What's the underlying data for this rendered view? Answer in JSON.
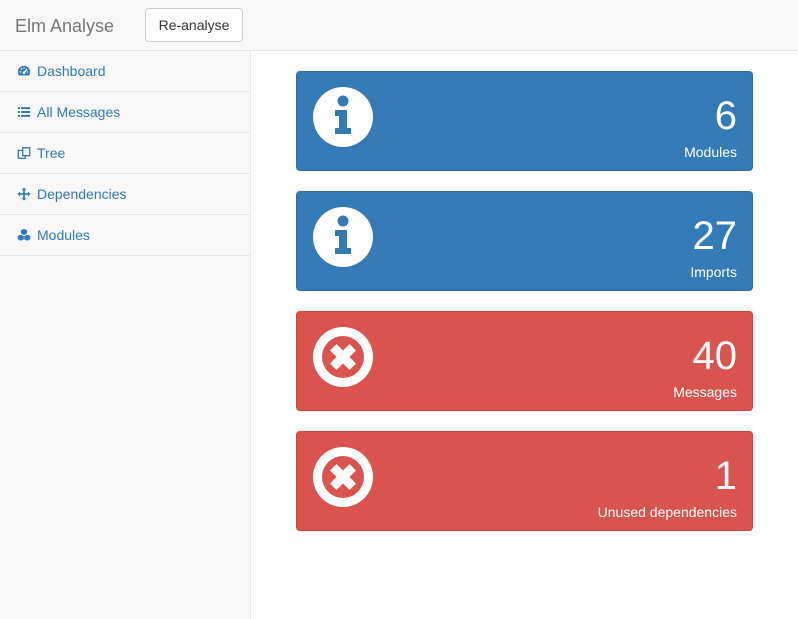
{
  "navbar": {
    "brand": "Elm Analyse",
    "reanalyse_label": "Re-analyse"
  },
  "sidebar": {
    "items": [
      {
        "label": "Dashboard",
        "icon": "dashboard-icon"
      },
      {
        "label": "All Messages",
        "icon": "list-icon"
      },
      {
        "label": "Tree",
        "icon": "tree-icon"
      },
      {
        "label": "Dependencies",
        "icon": "arrows-icon"
      },
      {
        "label": "Modules",
        "icon": "cubes-icon"
      }
    ]
  },
  "cards": [
    {
      "count": "6",
      "label": "Modules",
      "status": "info",
      "icon": "info-circle-icon",
      "color": "#337ab7"
    },
    {
      "count": "27",
      "label": "Imports",
      "status": "info",
      "icon": "info-circle-icon",
      "color": "#337ab7"
    },
    {
      "count": "40",
      "label": "Messages",
      "status": "error",
      "icon": "times-circle-icon",
      "color": "#d9534f"
    },
    {
      "count": "1",
      "label": "Unused dependencies",
      "status": "error",
      "icon": "times-circle-icon",
      "color": "#d9534f"
    }
  ]
}
